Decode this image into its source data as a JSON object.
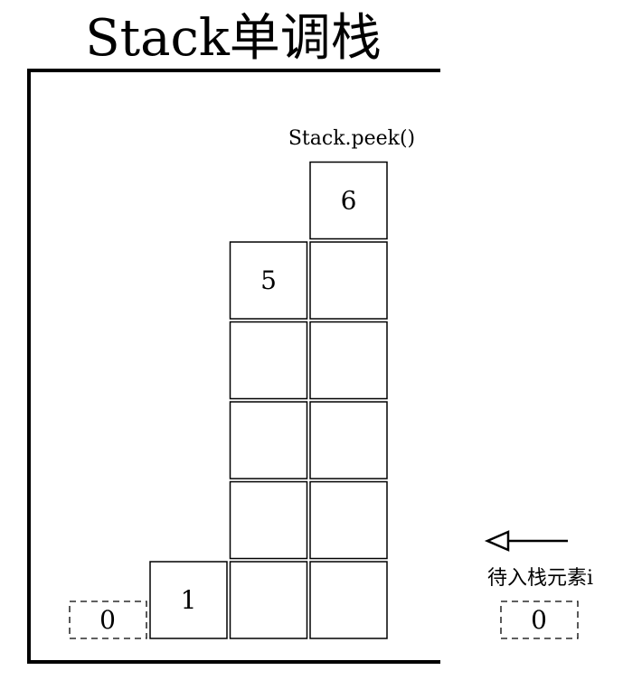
{
  "title": "Stack单调栈",
  "peek_label": "Stack.peek()",
  "incoming_label": "待入栈元素i",
  "incoming_value": "0",
  "popped_value": "0",
  "bars": [
    {
      "label": "1",
      "height": 1
    },
    {
      "label": "5",
      "height": 5
    },
    {
      "label": "6",
      "height": 6
    }
  ]
}
